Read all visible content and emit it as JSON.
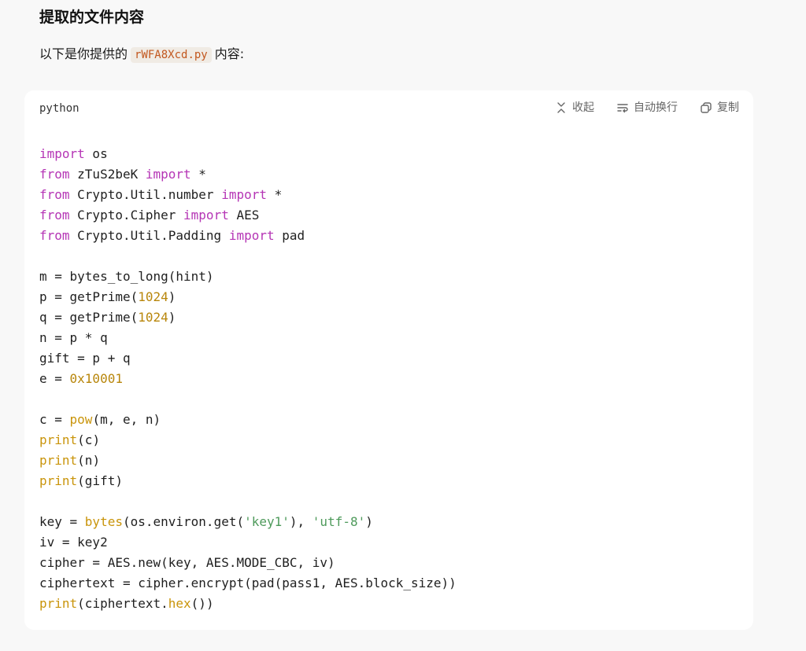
{
  "heading": "提取的文件内容",
  "intro": {
    "before": "以下是你提供的",
    "filename": "rWFA8Xcd.py",
    "after": "内容:"
  },
  "code_block": {
    "language": "python",
    "actions": {
      "collapse": "收起",
      "wrap": "自动换行",
      "copy": "复制"
    },
    "lines": [
      [
        [
          "kw",
          "import"
        ],
        [
          "plain",
          " os"
        ]
      ],
      [
        [
          "kw",
          "from"
        ],
        [
          "plain",
          " zTuS2beK "
        ],
        [
          "kw",
          "import"
        ],
        [
          "plain",
          " *"
        ]
      ],
      [
        [
          "kw",
          "from"
        ],
        [
          "plain",
          " Crypto.Util.number "
        ],
        [
          "kw",
          "import"
        ],
        [
          "plain",
          " *"
        ]
      ],
      [
        [
          "kw",
          "from"
        ],
        [
          "plain",
          " Crypto.Cipher "
        ],
        [
          "kw",
          "import"
        ],
        [
          "plain",
          " AES"
        ]
      ],
      [
        [
          "kw",
          "from"
        ],
        [
          "plain",
          " Crypto.Util.Padding "
        ],
        [
          "kw",
          "import"
        ],
        [
          "plain",
          " pad"
        ]
      ],
      [],
      [
        [
          "plain",
          "m = bytes_to_long(hint)"
        ]
      ],
      [
        [
          "plain",
          "p = getPrime("
        ],
        [
          "num",
          "1024"
        ],
        [
          "plain",
          ")"
        ]
      ],
      [
        [
          "plain",
          "q = getPrime("
        ],
        [
          "num",
          "1024"
        ],
        [
          "plain",
          ")"
        ]
      ],
      [
        [
          "plain",
          "n = p * q"
        ]
      ],
      [
        [
          "plain",
          "gift = p + q"
        ]
      ],
      [
        [
          "plain",
          "e = "
        ],
        [
          "num",
          "0x10001"
        ]
      ],
      [],
      [
        [
          "plain",
          "c = "
        ],
        [
          "fn",
          "pow"
        ],
        [
          "plain",
          "(m, e, n)"
        ]
      ],
      [
        [
          "fn",
          "print"
        ],
        [
          "plain",
          "(c)"
        ]
      ],
      [
        [
          "fn",
          "print"
        ],
        [
          "plain",
          "(n)"
        ]
      ],
      [
        [
          "fn",
          "print"
        ],
        [
          "plain",
          "(gift)"
        ]
      ],
      [],
      [
        [
          "plain",
          "key = "
        ],
        [
          "fn",
          "bytes"
        ],
        [
          "plain",
          "(os.environ.get("
        ],
        [
          "str",
          "'key1'"
        ],
        [
          "plain",
          "), "
        ],
        [
          "str",
          "'utf-8'"
        ],
        [
          "plain",
          ")"
        ]
      ],
      [
        [
          "plain",
          "iv = key2"
        ]
      ],
      [
        [
          "plain",
          "cipher = AES.new(key, AES.MODE_CBC, iv)"
        ]
      ],
      [
        [
          "plain",
          "ciphertext = cipher.encrypt(pad(pass1, AES.block_size))"
        ]
      ],
      [
        [
          "fn",
          "print"
        ],
        [
          "plain",
          "(ciphertext."
        ],
        [
          "fn",
          "hex"
        ],
        [
          "plain",
          "())"
        ]
      ]
    ]
  },
  "colors": {
    "keyword": "#b535b5",
    "number": "#b8860b",
    "builtin": "#c9940a",
    "string": "#4e9a5b",
    "inline_code_text": "#c2571e"
  },
  "icons": [
    "collapse-icon",
    "wrap-icon",
    "copy-icon"
  ]
}
